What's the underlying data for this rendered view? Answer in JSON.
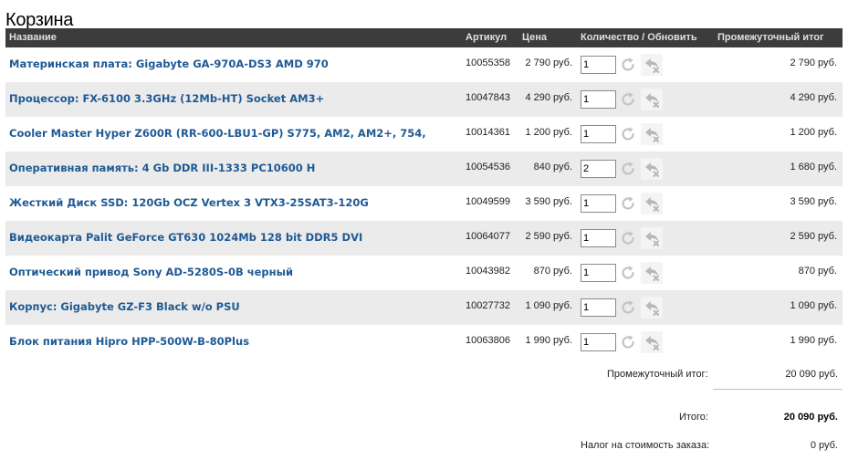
{
  "page": {
    "title": "Корзина"
  },
  "header": {
    "name": "Название",
    "sku": "Артикул",
    "price": "Цена",
    "qty": "Количество / Обновить",
    "subtotal": "Промежуточный итог"
  },
  "items": [
    {
      "name": "Материнская плата: Gigabyte GA-970A-DS3 AMD 970",
      "sku": "10055358",
      "price": "2 790 руб.",
      "qty": "1",
      "subtotal": "2 790 руб."
    },
    {
      "name": "Процессор: FX-6100 3.3GHz (12Mb-HT) Socket AM3+",
      "sku": "10047843",
      "price": "4 290 руб.",
      "qty": "1",
      "subtotal": "4 290 руб."
    },
    {
      "name": "Cooler Master Hyper Z600R (RR-600-LBU1-GP) S775, AM2, AM2+, 754,",
      "sku": "10014361",
      "price": "1 200 руб.",
      "qty": "1",
      "subtotal": "1 200 руб."
    },
    {
      "name": "Оперативная память: 4 Gb DDR III-1333 PC10600 H",
      "sku": "10054536",
      "price": "840 руб.",
      "qty": "2",
      "subtotal": "1 680 руб."
    },
    {
      "name": "Жесткий Диск SSD: 120Gb OCZ Vertex 3 VTX3-25SAT3-120G",
      "sku": "10049599",
      "price": "3 590 руб.",
      "qty": "1",
      "subtotal": "3 590 руб."
    },
    {
      "name": "Видеокарта Palit GeForce GT630 1024Mb 128 bit DDR5 DVI",
      "sku": "10064077",
      "price": "2 590 руб.",
      "qty": "1",
      "subtotal": "2 590 руб."
    },
    {
      "name": "Оптический привод Sony AD-5280S-0B черный",
      "sku": "10043982",
      "price": "870 руб.",
      "qty": "1",
      "subtotal": "870 руб."
    },
    {
      "name": "Корпус: Gigabyte GZ-F3 Black w/o PSU",
      "sku": "10027732",
      "price": "1 090 руб.",
      "qty": "1",
      "subtotal": "1 090 руб."
    },
    {
      "name": "Блок питания Hipro HPP-500W-B-80Plus",
      "sku": "10063806",
      "price": "1 990 руб.",
      "qty": "1",
      "subtotal": "1 990 руб."
    }
  ],
  "summary": {
    "subtotal_label": "Промежуточный итог:",
    "subtotal_value": "20 090 руб.",
    "total_label": "Итого:",
    "total_value": "20 090 руб.",
    "tax_label": "Налог на стоимость заказа:",
    "tax_value": "0 руб."
  },
  "icons": {
    "refresh": "refresh-icon",
    "remove": "remove-icon"
  },
  "colors": {
    "header_bg": "#3c3c3c",
    "link": "#1f5a94",
    "alt_row": "#ebebeb"
  }
}
